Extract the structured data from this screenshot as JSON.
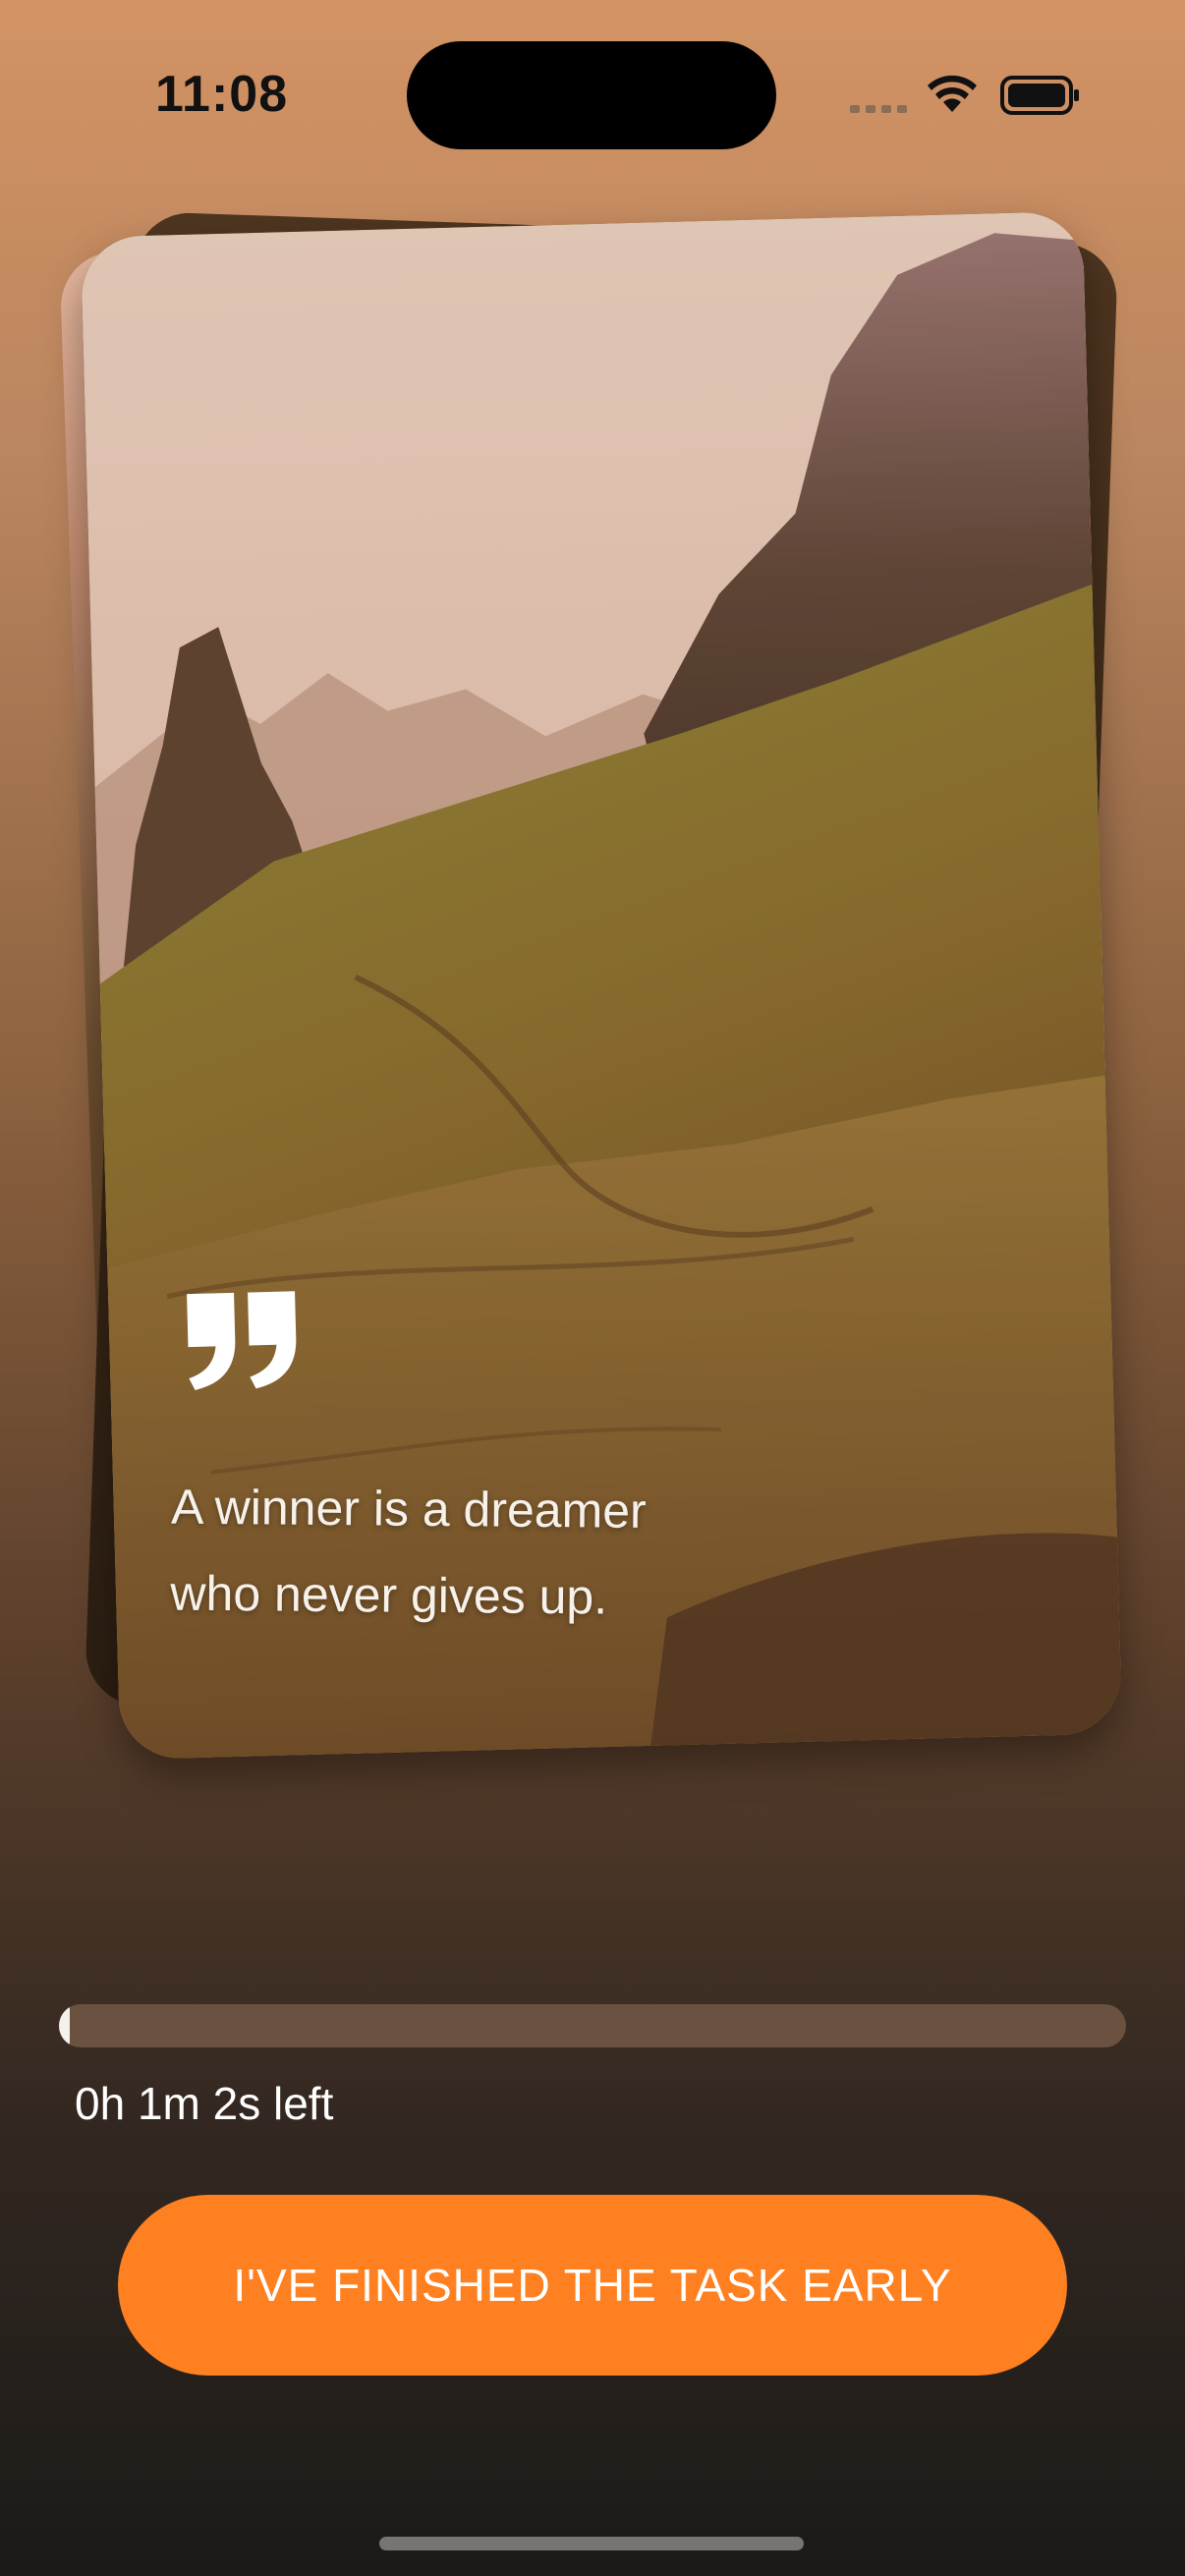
{
  "status_bar": {
    "time": "11:08",
    "icons": [
      "signal-dots-icon",
      "wifi-icon",
      "battery-icon"
    ]
  },
  "quote_card": {
    "icon": "quote-mark-icon",
    "quote_lines": [
      "A winner is a dreamer",
      "who never gives up."
    ]
  },
  "timer": {
    "progress_fraction": 0.01,
    "time_left_text": "0h 1m 2s left"
  },
  "actions": {
    "finish_label": "I'VE FINISHED THE TASK EARLY"
  },
  "colors": {
    "accent": "#ff8020",
    "progress_track": "#6b5140",
    "progress_fill": "#f4f0ec"
  }
}
